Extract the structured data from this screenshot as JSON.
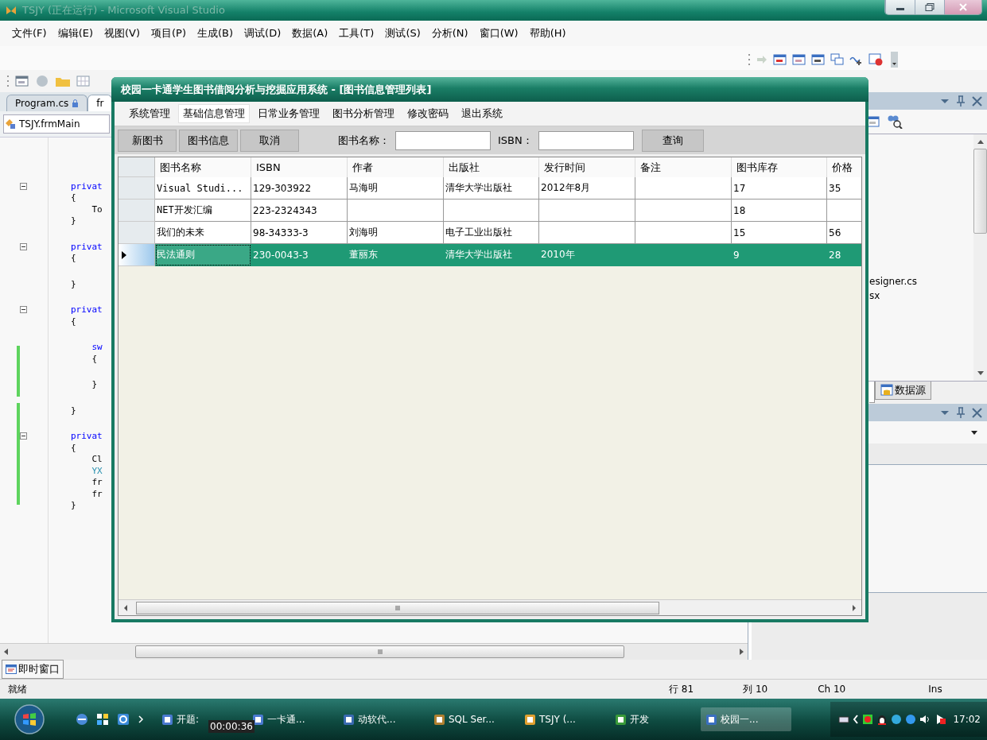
{
  "window": {
    "title": "TSJY (正在运行) - Microsoft Visual Studio"
  },
  "menu": [
    "文件(F)",
    "编辑(E)",
    "视图(V)",
    "项目(P)",
    "生成(B)",
    "调试(D)",
    "数据(A)",
    "工具(T)",
    "测试(S)",
    "分析(N)",
    "窗口(W)",
    "帮助(H)"
  ],
  "document_tabs": [
    {
      "label": "Program.cs",
      "selected": false
    },
    {
      "label": "fr",
      "selected": true
    }
  ],
  "navigation": {
    "class_combo": "TSJY.frmMain"
  },
  "code_blocks": [
    {
      "lines": [
        {
          "text": "privat",
          "kind": "keyword",
          "foldable": true
        },
        {
          "text": "{",
          "kind": "plain",
          "foldable": false
        },
        {
          "text": "    To",
          "kind": "plain",
          "foldable": false
        },
        {
          "text": "}",
          "kind": "plain",
          "foldable": false
        }
      ]
    },
    {
      "lines": [
        {
          "text": "privat",
          "kind": "keyword",
          "foldable": true
        },
        {
          "text": "{",
          "kind": "plain",
          "foldable": false
        }
      ]
    },
    {
      "lines": [
        {
          "text": "}",
          "kind": "plain",
          "foldable": false
        }
      ]
    },
    {
      "lines": [
        {
          "text": "privat",
          "kind": "keyword",
          "foldable": true
        },
        {
          "text": "{",
          "kind": "plain",
          "foldable": false
        }
      ]
    },
    {
      "lines": [
        {
          "text": "    sw",
          "kind": "keyword",
          "foldable": false
        },
        {
          "text": "    {",
          "kind": "plain",
          "foldable": false
        }
      ]
    },
    {
      "lines": [
        {
          "text": "    }",
          "kind": "plain",
          "foldable": false
        }
      ]
    },
    {
      "lines": [
        {
          "text": "}",
          "kind": "plain",
          "foldable": false
        }
      ]
    },
    {
      "lines": [
        {
          "text": "privat",
          "kind": "keyword",
          "foldable": true
        },
        {
          "text": "{",
          "kind": "plain",
          "foldable": false
        },
        {
          "text": "    Cl",
          "kind": "plain",
          "foldable": false
        },
        {
          "text": "    YX",
          "kind": "type",
          "foldable": false
        },
        {
          "text": "    fr",
          "kind": "plain",
          "foldable": false
        },
        {
          "text": "    fr",
          "kind": "plain",
          "foldable": false
        },
        {
          "text": "}",
          "kind": "plain",
          "foldable": false
        }
      ]
    }
  ],
  "right_panel": {
    "tree_items": [
      "esigner.cs",
      "sx"
    ],
    "tabs": [
      {
        "selected": true
      },
      {
        "label": "数据源",
        "selected": false
      }
    ]
  },
  "bottom_tabs": [
    {
      "label": "即时窗口",
      "selected": true
    }
  ],
  "status_bar": {
    "message": "就绪",
    "line": "行 81",
    "column": "列 10",
    "char": "Ch 10",
    "mode": "Ins"
  },
  "taskbar": {
    "items": [
      {
        "label": "开题:",
        "selected": false
      },
      {
        "label": "一卡通...",
        "selected": false
      },
      {
        "label": "动软代...",
        "selected": false
      },
      {
        "label": "SQL Ser...",
        "selected": false
      },
      {
        "label": "TSJY (...",
        "selected": false
      },
      {
        "label": "开发",
        "selected": false
      },
      {
        "label": "校园一...",
        "selected": true
      }
    ],
    "clock": "17:02"
  },
  "recording_timer": "00:00:36",
  "app_window": {
    "title": "校园一卡通学生图书借阅分析与挖掘应用系统 - [图书信息管理列表]",
    "menu": [
      {
        "label": "系统管理",
        "highlighted": false
      },
      {
        "label": "基础信息管理",
        "highlighted": true
      },
      {
        "label": "日常业务管理",
        "highlighted": false
      },
      {
        "label": "图书分析管理",
        "highlighted": false
      },
      {
        "label": "修改密码",
        "highlighted": false
      },
      {
        "label": "退出系统",
        "highlighted": false
      }
    ],
    "buttons": [
      "新图书",
      "图书信息",
      "取消"
    ],
    "search_fields": [
      {
        "label": "图书名称："
      },
      {
        "label": "ISBN："
      }
    ],
    "query_button": "查询",
    "grid": {
      "columns": [
        "图书名称",
        "ISBN",
        "作者",
        "出版社",
        "发行时间",
        "备注",
        "图书库存",
        "价格"
      ],
      "rows": [
        {
          "selected": false,
          "cells": [
            "Visual Studi...",
            "129-303922",
            "马海明",
            "清华大学出版社",
            "2012年8月",
            null,
            "17",
            "35"
          ]
        },
        {
          "selected": false,
          "cells": [
            "NET开发汇编",
            "223-2324343",
            null,
            null,
            null,
            null,
            "18",
            null
          ]
        },
        {
          "selected": false,
          "cells": [
            "我们的未来",
            "98-34333-3",
            "刘海明",
            "电子工业出版社",
            null,
            null,
            "15",
            "56"
          ]
        },
        {
          "selected": true,
          "cells": [
            "民法通则",
            "230-0043-3",
            "董丽东",
            "清华大学出版社",
            "2010年",
            null,
            "9",
            "28"
          ]
        }
      ]
    }
  }
}
